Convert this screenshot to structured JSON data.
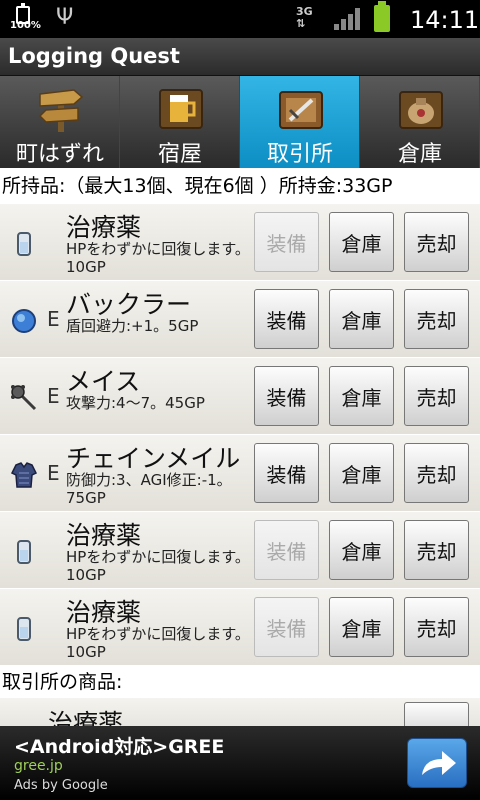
{
  "status_bar": {
    "battery_left_pct": "100%",
    "time": "14:11",
    "network": "3G"
  },
  "app": {
    "title": "Logging Quest"
  },
  "tabs": [
    {
      "label": "町はずれ",
      "icon": "signpost-icon",
      "active": false
    },
    {
      "label": "宿屋",
      "icon": "beer-mug-icon",
      "active": false
    },
    {
      "label": "取引所",
      "icon": "sword-sign-icon",
      "active": true
    },
    {
      "label": "倉庫",
      "icon": "bag-sign-icon",
      "active": false
    }
  ],
  "inventory_header": "所持品:（最大13個、現在6個 ）所持金:33GP",
  "items": [
    {
      "name": "治療薬",
      "desc": "HPをわずかに回復します。10GP",
      "icon": "potion-icon",
      "equipped_mark": "",
      "equip_enabled": false
    },
    {
      "name": "バックラー",
      "desc": "盾回避力:+1。5GP",
      "icon": "shield-icon",
      "equipped_mark": "E",
      "equip_enabled": true
    },
    {
      "name": "メイス",
      "desc": "攻撃力:4～7。45GP",
      "icon": "mace-icon",
      "equipped_mark": "E",
      "equip_enabled": true
    },
    {
      "name": "チェインメイル",
      "desc": "防御力:3、AGI修正:-1。75GP",
      "icon": "armor-icon",
      "equipped_mark": "E",
      "equip_enabled": true
    },
    {
      "name": "治療薬",
      "desc": "HPをわずかに回復します。10GP",
      "icon": "potion-icon",
      "equipped_mark": "",
      "equip_enabled": false
    },
    {
      "name": "治療薬",
      "desc": "HPをわずかに回復します。10GP",
      "icon": "potion-icon",
      "equipped_mark": "",
      "equip_enabled": false
    }
  ],
  "buttons": {
    "equip": "装備",
    "store": "倉庫",
    "sell": "売却",
    "buy": ""
  },
  "shop_header": "取引所の商品:",
  "shop_items": [
    {
      "name": "治療薬"
    }
  ],
  "ad": {
    "title": "<Android対応>GREE",
    "url": "gree.jp",
    "by": "Ads by Google"
  }
}
